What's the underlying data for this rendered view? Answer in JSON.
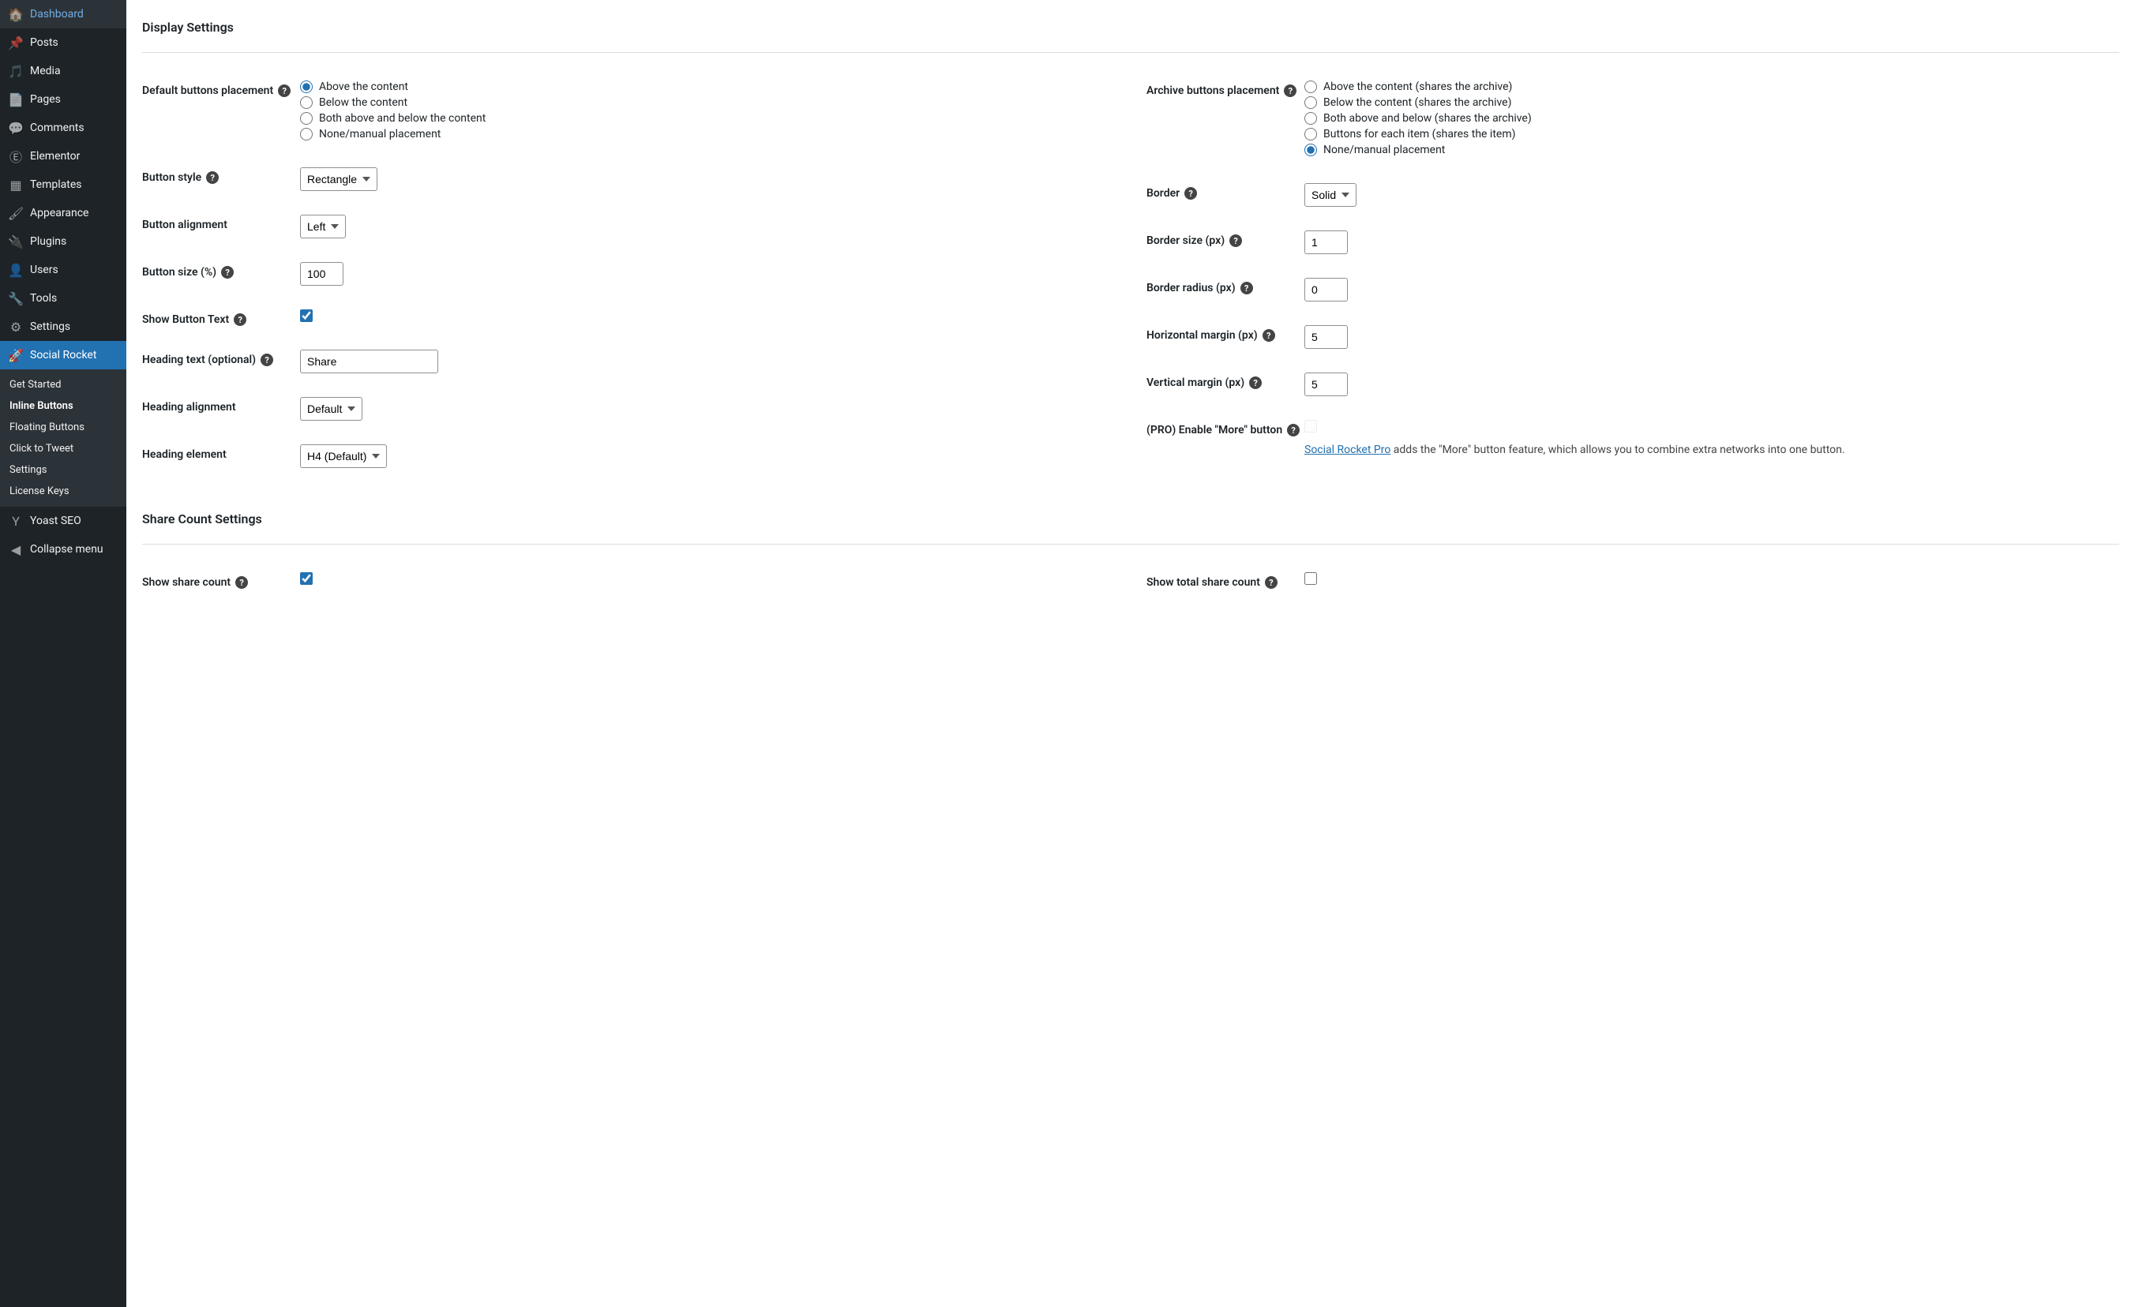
{
  "sidebar": {
    "items": [
      {
        "icon": "🏠",
        "label": "Dashboard"
      },
      {
        "icon": "📌",
        "label": "Posts"
      },
      {
        "icon": "🎵",
        "label": "Media"
      },
      {
        "icon": "📄",
        "label": "Pages"
      },
      {
        "icon": "💬",
        "label": "Comments"
      },
      {
        "icon": "Ⓔ",
        "label": "Elementor"
      },
      {
        "icon": "▦",
        "label": "Templates"
      },
      {
        "icon": "🖌",
        "label": "Appearance"
      },
      {
        "icon": "🔌",
        "label": "Plugins"
      },
      {
        "icon": "👤",
        "label": "Users"
      },
      {
        "icon": "🔧",
        "label": "Tools"
      },
      {
        "icon": "⚙",
        "label": "Settings"
      },
      {
        "icon": "🚀",
        "label": "Social Rocket",
        "active": true
      },
      {
        "icon": "Y",
        "label": "Yoast SEO"
      },
      {
        "icon": "◀",
        "label": "Collapse menu"
      }
    ],
    "sub": [
      "Get Started",
      "Inline Buttons",
      "Floating Buttons",
      "Click to Tweet",
      "Settings",
      "License Keys"
    ],
    "sub_active": 1
  },
  "sections": {
    "display": "Display Settings",
    "share": "Share Count Settings"
  },
  "left": {
    "default_placement": {
      "label": "Default buttons placement",
      "options": [
        "Above the content",
        "Below the content",
        "Both above and below the content",
        "None/manual placement"
      ],
      "selected": 0
    },
    "button_style": {
      "label": "Button style",
      "value": "Rectangle"
    },
    "button_alignment": {
      "label": "Button alignment",
      "value": "Left"
    },
    "button_size": {
      "label": "Button size (%)",
      "value": "100"
    },
    "show_button_text": {
      "label": "Show Button Text",
      "checked": true
    },
    "heading_text": {
      "label": "Heading text (optional)",
      "value": "Share"
    },
    "heading_alignment": {
      "label": "Heading alignment",
      "value": "Default"
    },
    "heading_element": {
      "label": "Heading element",
      "value": "H4 (Default)"
    },
    "show_share_count": {
      "label": "Show share count",
      "checked": true
    }
  },
  "right": {
    "archive_placement": {
      "label": "Archive buttons placement",
      "options": [
        "Above the content (shares the archive)",
        "Below the content (shares the archive)",
        "Both above and below (shares the archive)",
        "Buttons for each item (shares the item)",
        "None/manual placement"
      ],
      "selected": 4
    },
    "border": {
      "label": "Border",
      "value": "Solid"
    },
    "border_size": {
      "label": "Border size (px)",
      "value": "1"
    },
    "border_radius": {
      "label": "Border radius (px)",
      "value": "0"
    },
    "h_margin": {
      "label": "Horizontal margin (px)",
      "value": "5"
    },
    "v_margin": {
      "label": "Vertical margin (px)",
      "value": "5"
    },
    "more_button": {
      "label": "(PRO) Enable \"More\" button",
      "link": "Social Rocket Pro",
      "desc": " adds the \"More\" button feature, which allows you to combine extra networks into one button."
    },
    "show_total": {
      "label": "Show total share count",
      "checked": false
    }
  }
}
